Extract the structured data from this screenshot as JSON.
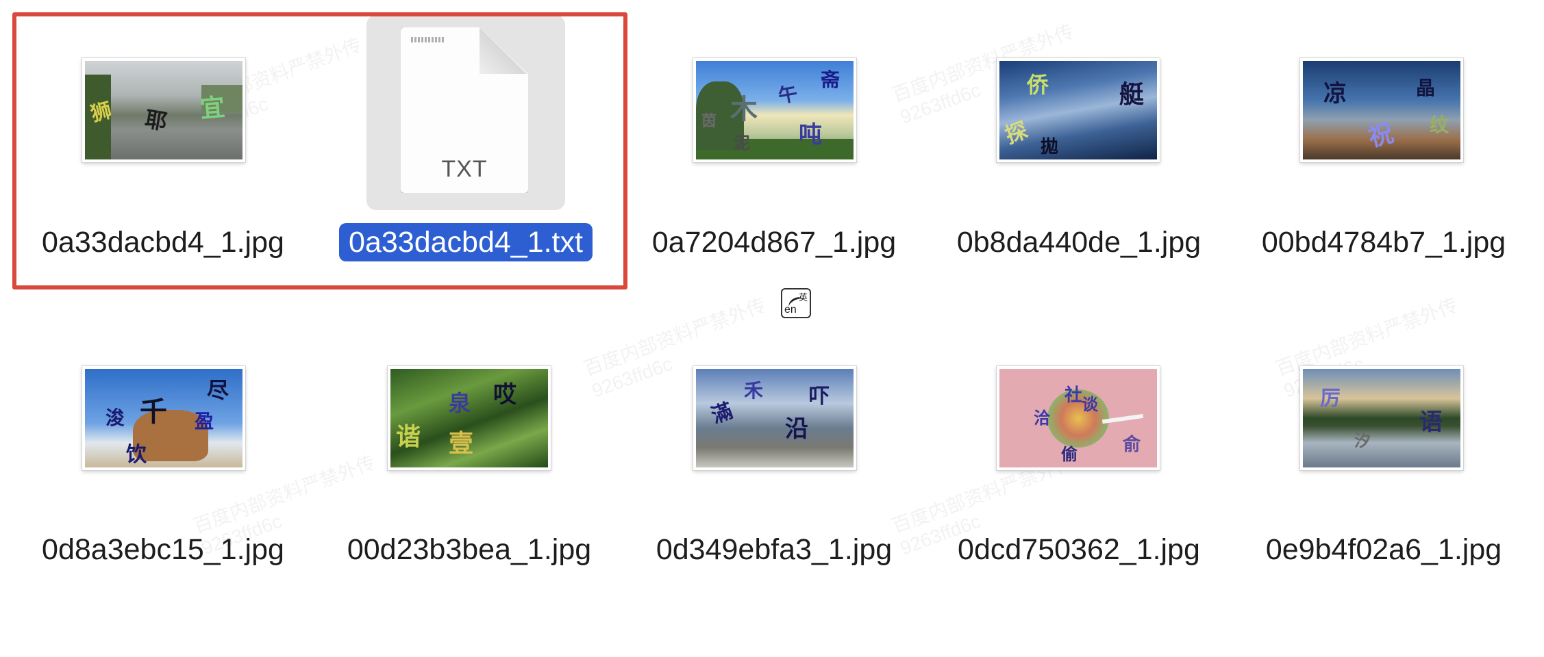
{
  "files": [
    {
      "name": "0a33dacbd4_1.jpg",
      "type": "jpg",
      "chars": [
        "狮",
        "耶",
        "宜"
      ]
    },
    {
      "name": "0a33dacbd4_1.txt",
      "type": "txt",
      "icon_label": "TXT",
      "selected": true
    },
    {
      "name": "0a7204d867_1.jpg",
      "type": "jpg",
      "chars": [
        "木",
        "午",
        "斋",
        "吨",
        "泥",
        "茵"
      ]
    },
    {
      "name": "0b8da440de_1.jpg",
      "type": "jpg",
      "chars": [
        "侨",
        "艇",
        "探",
        "拋"
      ]
    },
    {
      "name": "00bd4784b7_1.jpg",
      "type": "jpg",
      "chars": [
        "凉",
        "晶",
        "祝",
        "纹"
      ]
    },
    {
      "name": "0d8a3ebc15_1.jpg",
      "type": "jpg",
      "chars": [
        "千",
        "尽",
        "盈",
        "浚",
        "饮"
      ]
    },
    {
      "name": "00d23b3bea_1.jpg",
      "type": "jpg",
      "chars": [
        "泉",
        "哎",
        "谐",
        "壹"
      ]
    },
    {
      "name": "0d349ebfa3_1.jpg",
      "type": "jpg",
      "chars": [
        "滿",
        "禾",
        "吓",
        "沿"
      ]
    },
    {
      "name": "0dcd750362_1.jpg",
      "type": "jpg",
      "chars": [
        "社",
        "谈",
        "洽",
        "偷",
        "俞"
      ]
    },
    {
      "name": "0e9b4f02a6_1.jpg",
      "type": "jpg",
      "chars": [
        "厉",
        "语",
        "汐"
      ]
    }
  ],
  "ime_icon": {
    "primary": "en",
    "secondary": "英"
  },
  "watermark": {
    "text": "百度内部资料严禁外传",
    "code": "9263ffd6c"
  },
  "colors": {
    "selection": "#2d5fd3",
    "highlight_box": "#d9483b",
    "txt_tile_bg": "#e4e4e4"
  }
}
